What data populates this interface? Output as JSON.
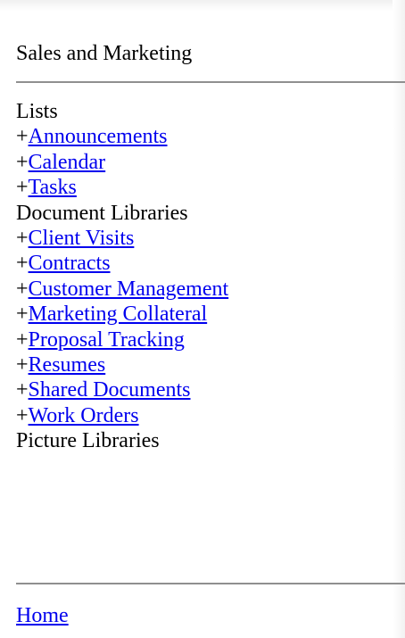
{
  "site_title": "Sales and Marketing",
  "sections": {
    "lists": {
      "heading": "Lists",
      "prefix": "+",
      "items": [
        "Announcements",
        "Calendar",
        "Tasks"
      ]
    },
    "document_libraries": {
      "heading": "Document Libraries",
      "prefix": "+",
      "items": [
        "Client Visits",
        "Contracts",
        "Customer Management",
        "Marketing Collateral",
        "Proposal Tracking",
        "Resumes",
        "Shared Documents",
        "Work Orders"
      ]
    },
    "picture_libraries": {
      "heading": "Picture Libraries"
    }
  },
  "footer": {
    "home_link": "Home"
  },
  "colors": {
    "link": "#0000ee",
    "text": "#000000",
    "rule": "#8f8f8f",
    "background": "#ffffff"
  }
}
